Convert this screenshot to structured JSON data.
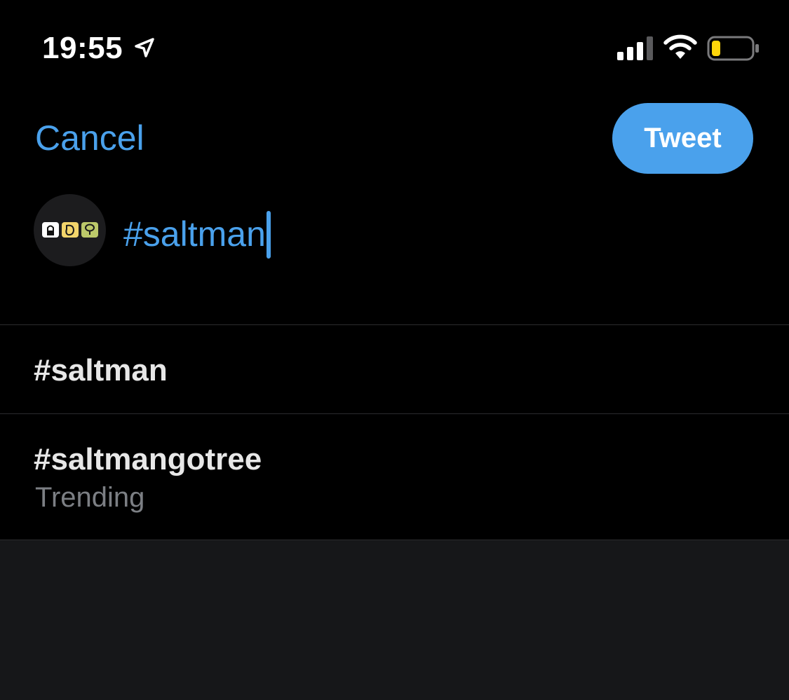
{
  "status_bar": {
    "time": "19:55",
    "icons": [
      "location-arrow-icon",
      "cellular-signal-icon",
      "wifi-icon",
      "battery-icon"
    ],
    "battery_color": "#ffd60a"
  },
  "header": {
    "cancel_label": "Cancel",
    "tweet_label": "Tweet"
  },
  "composer": {
    "text": "#saltman",
    "avatar_icons": [
      "salt-shaker-icon",
      "mango-icon",
      "tree-icon"
    ]
  },
  "suggestions": [
    {
      "title": "#saltman",
      "subtitle": ""
    },
    {
      "title": "#saltmangotree",
      "subtitle": "Trending"
    }
  ],
  "colors": {
    "accent": "#4aa1ec",
    "background": "#000000",
    "divider": "#2c2c2e",
    "secondary_text": "#7c7f84",
    "bottom_panel": "#161719"
  }
}
